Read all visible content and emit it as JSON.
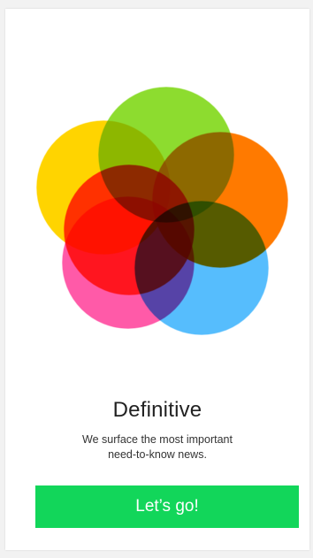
{
  "onboarding": {
    "title": "Definitive",
    "subtitle_line1": "We surface the most important",
    "subtitle_line2": "need-to-know news.",
    "cta_label": "Let’s go!"
  },
  "illustration": {
    "name": "overlapping-color-circles",
    "circle_colors": [
      "#ffd400",
      "#8ddc2f",
      "#ff7a00",
      "#ff3a2e",
      "#ff5aa8",
      "#56bdfd"
    ]
  },
  "colors": {
    "cta_background": "#12d65a",
    "cta_text": "#ffffff",
    "title_text": "#222222",
    "background": "#ffffff"
  }
}
